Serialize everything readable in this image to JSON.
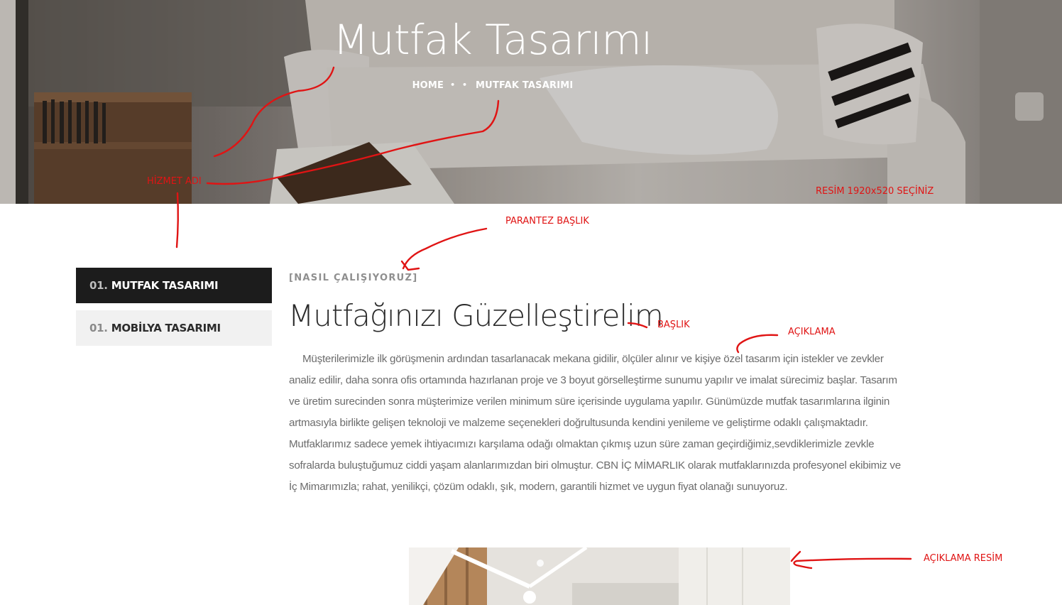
{
  "hero": {
    "title": "Mutfak Tasarımı",
    "breadcrumb": {
      "home": "HOME",
      "separator": "• •",
      "current": "MUTFAK TASARIMI"
    }
  },
  "sidebar": {
    "items": [
      {
        "num": "01.",
        "label": "MUTFAK TASARIMI",
        "active": true
      },
      {
        "num": "01.",
        "label": "MOBİLYA TASARIMI",
        "active": false
      }
    ]
  },
  "content": {
    "kicker": "[NASIL ÇALIŞIYORUZ]",
    "heading": "Mutfağınızı Güzelleştirelim",
    "paragraph": "Müşterilerimizle ilk görüşmenin ardından tasarlanacak mekana gidilir, ölçüler alınır ve kişiye özel tasarım için istekler ve zevkler analiz edilir, daha sonra ofis ortamında hazırlanan proje ve 3 boyut görselleştirme sunumu yapılır ve imalat sürecimiz başlar. Tasarım ve üretim surecinden sonra müşterimize verilen minimum süre içerisinde uygulama yapılır. Günümüzde mutfak tasarımlarına ilginin artmasıyla birlikte gelişen teknoloji ve malzeme seçenekleri doğrultusunda kendini yenileme ve geliştirme odaklı çalışmaktadır. Mutfaklarımız sadece yemek ihtiyacımızı karşılama odağı olmaktan çıkmış uzun süre zaman geçirdiğimiz,sevdiklerimizle zevkle sofralarda buluştuğumuz ciddi yaşam alanlarımızdan biri olmuştur. CBN İÇ MİMARLIK olarak mutfaklarınızda profesyonel ekibimiz ve İç Mimarımızla; rahat, yenilikçi, çözüm odaklı, şık, modern, garantili hizmet ve uygun fiyat olanağı sunuyoruz."
  },
  "annotations": {
    "hizmet_adi": "HİZMET ADI",
    "resim": "RESİM 1920x520 SEÇİNİZ",
    "parantez_baslik": "PARANTEZ  BAŞLIK",
    "baslik": "BAŞLIK",
    "aciklama": "AÇIKLAMA",
    "aciklama_resim": "AÇIKLAMA RESİM"
  },
  "colors": {
    "annotation": "#e01414",
    "active_bg": "#1c1c1c",
    "inactive_bg": "#f1f1f1"
  }
}
